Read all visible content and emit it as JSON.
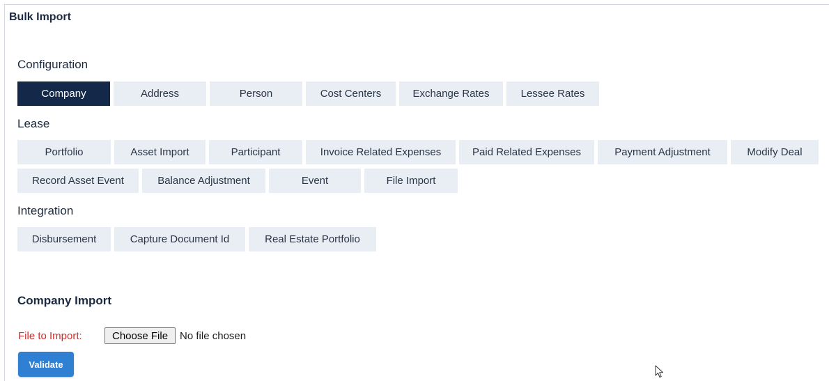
{
  "page": {
    "title": "Bulk Import"
  },
  "sections": {
    "configuration": {
      "title": "Configuration",
      "tabs": [
        "Company",
        "Address",
        "Person",
        "Cost Centers",
        "Exchange Rates",
        "Lessee Rates"
      ],
      "active": "Company"
    },
    "lease": {
      "title": "Lease",
      "tabs_row1": [
        "Portfolio",
        "Asset Import",
        "Participant",
        "Invoice Related Expenses",
        "Paid Related Expenses",
        "Payment Adjustment",
        "Modify Deal"
      ],
      "tabs_row2": [
        "Record Asset Event",
        "Balance Adjustment",
        "Event",
        "File Import"
      ]
    },
    "integration": {
      "title": "Integration",
      "tabs": [
        "Disbursement",
        "Capture Document Id",
        "Real Estate Portfolio"
      ]
    }
  },
  "import_form": {
    "title": "Company Import",
    "file_label": "File to Import:",
    "choose_button": "Choose File",
    "file_status": "No file chosen",
    "validate_button": "Validate"
  },
  "colors": {
    "tab_bg": "#e9eef5",
    "tab_active_bg": "#14284a",
    "label_red": "#d42b2b",
    "validate_blue": "#2f7fd3"
  },
  "icons": {
    "cursor": "mouse-pointer-icon"
  }
}
